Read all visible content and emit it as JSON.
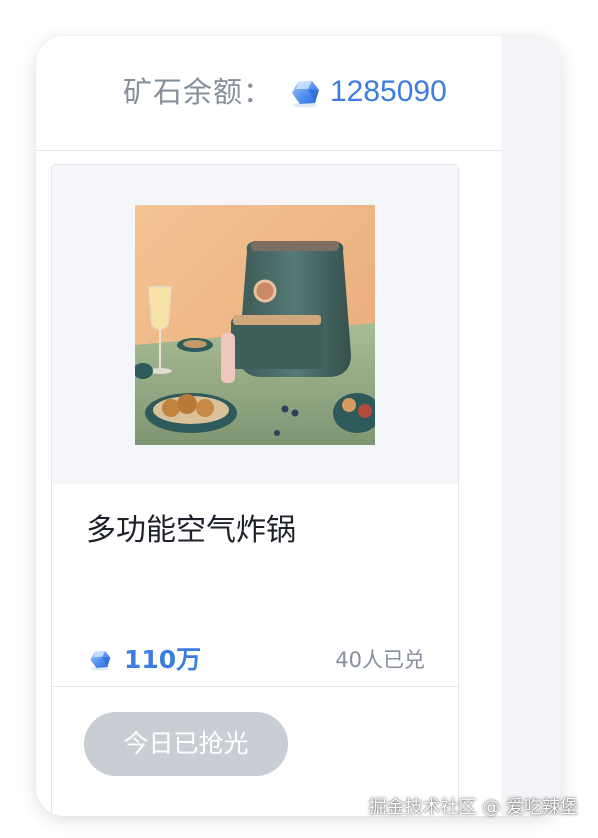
{
  "header": {
    "balance_label": "矿石余额：",
    "balance_value": "1285090",
    "ore_icon": "ore-crystal-icon"
  },
  "product": {
    "name": "多功能空气炸锅",
    "image": "air-fryer-photo",
    "price": "110万",
    "redeemed_count": "40人已兑",
    "button_label": "今日已抢光"
  },
  "watermark": "掘金技术社区 @ 爱吃辣堡",
  "colors": {
    "accent": "#3d7de0",
    "muted_text": "#86909c",
    "disabled_button": "#c9cdd4",
    "image_bg": "#f5f6f9",
    "gutter_bg": "#f2f4f7"
  }
}
